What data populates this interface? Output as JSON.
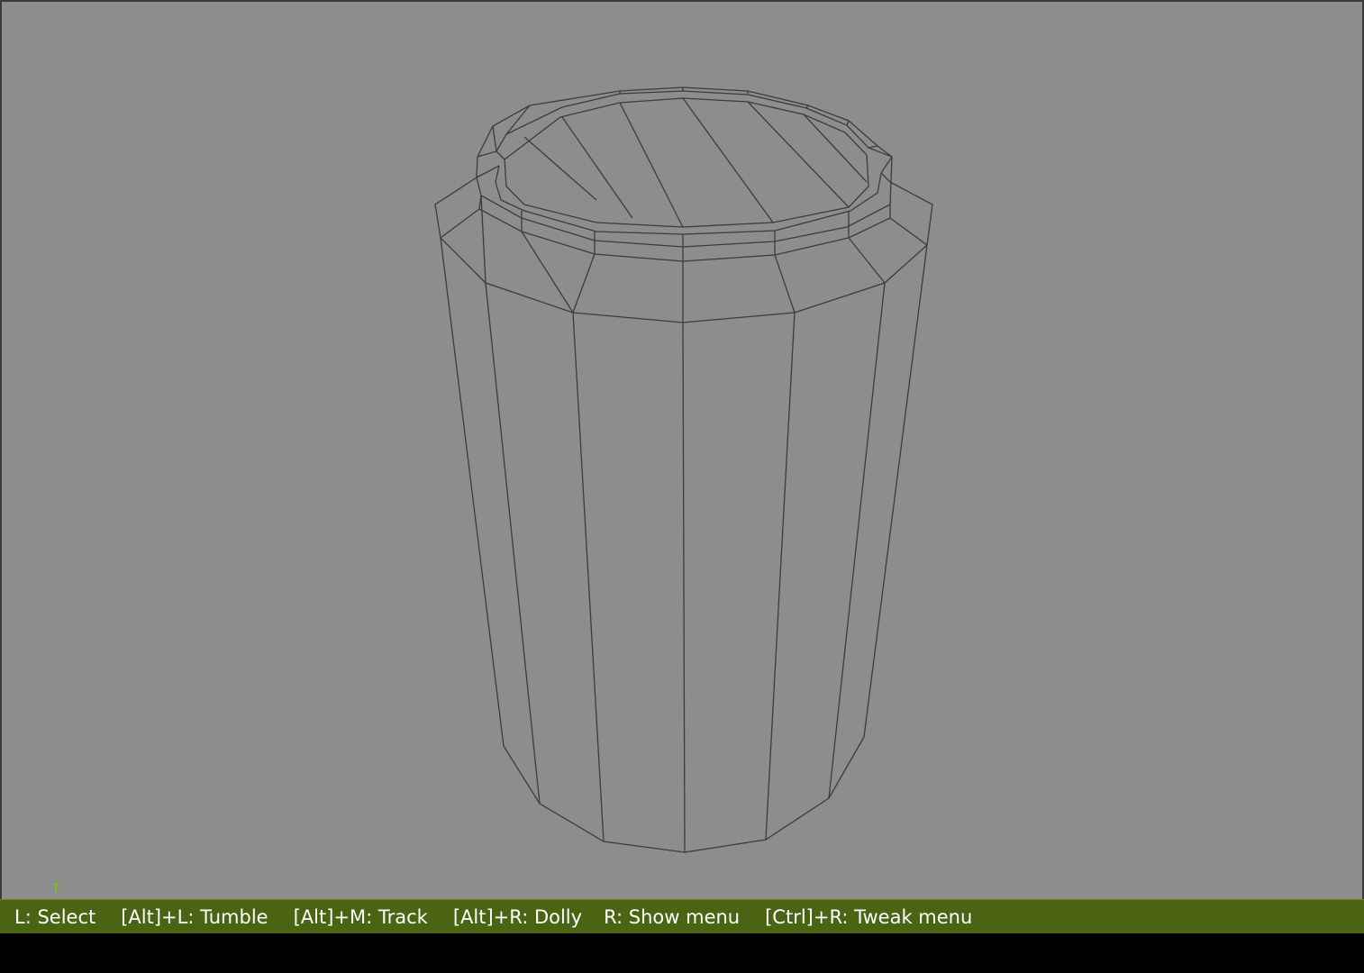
{
  "colors": {
    "viewport_bg": "#8d8d8d",
    "wireframe": "#3c3c3c",
    "statusbar_bg": "#4b6414",
    "statusbar_text": "#ffffff",
    "axis_marker": "#7fb82e"
  },
  "viewport": {
    "object": "cylinder-can-wireframe",
    "axis_icon": "axis-marker-icon"
  },
  "statusbar": {
    "hints": [
      "L: Select",
      "[Alt]+L: Tumble",
      "[Alt]+M: Track",
      "[Alt]+R: Dolly",
      "R: Show menu",
      "[Ctrl]+R: Tweak menu"
    ]
  }
}
